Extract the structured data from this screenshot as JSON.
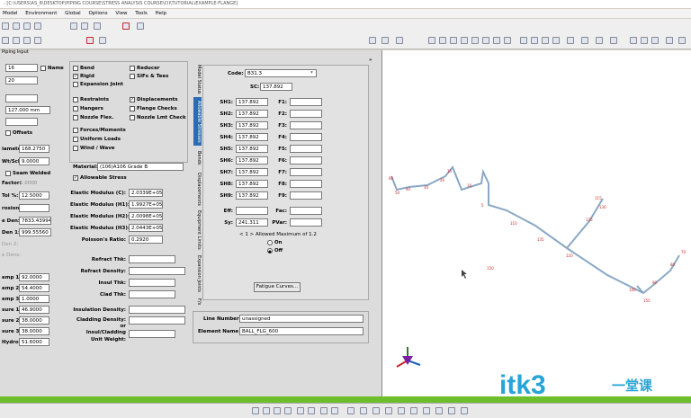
{
  "window": {
    "title": "- [C:\\USERS\\AS_8\\DESKTOP\\PIPING COURSE\\STRESS ANALYSIS COURSE\\CII\\TUTORIAL\\EXAMPLE-FLANGE]"
  },
  "menu": [
    "Model",
    "Environment",
    "Global",
    "Options",
    "View",
    "Tools",
    "Help"
  ],
  "panel": {
    "title": "Piping Input"
  },
  "left": {
    "from": "16",
    "to": "20",
    "dx": "",
    "dy": "127.000 mm",
    "dz": "",
    "name_label": "Name",
    "offsets_label": "Offsets",
    "diameter_label": "iameter:",
    "diameter": "168.2750",
    "wt_label": "Wt/Sch:",
    "wt": "9.0000",
    "seam_label": "Seam Welded",
    "factor_label": "Factor:",
    "factor": "1.0000",
    "mill_label": "Tol %:",
    "mill": "12.5000",
    "corr_label": "rosion:",
    "corr": "",
    "insul_label": "e Den:",
    "insul": "7833.43994",
    "fluid_label": "Den 1:",
    "fluid": "999.55560",
    "den2_label": "Den 2:",
    "other_label": "e Dens:",
    "temps": [
      {
        "label": "emp 1:",
        "value": "92.0000"
      },
      {
        "label": "emp 2:",
        "value": "54.4000"
      },
      {
        "label": "emp 3:",
        "value": "1.0000"
      },
      {
        "label": "sure 1:",
        "value": "46.9000"
      },
      {
        "label": "sure 2:",
        "value": "38.0000"
      },
      {
        "label": "sure 3:",
        "value": "38.0000"
      },
      {
        "label": "Hydro",
        "value": "51.6000"
      }
    ]
  },
  "mid": {
    "checks": [
      {
        "label": "Bend",
        "checked": false
      },
      {
        "label": "Reducer",
        "checked": false
      },
      {
        "label": "Rigid",
        "checked": true
      },
      {
        "label": "SIFs & Tees",
        "checked": false
      },
      {
        "label": "Expansion Joint",
        "checked": false
      },
      {
        "label": "Restraints",
        "checked": false
      },
      {
        "label": "Displacements",
        "checked": true
      },
      {
        "label": "Hangers",
        "checked": false
      },
      {
        "label": "Flange Checks",
        "checked": false
      },
      {
        "label": "Nozzle Flex.",
        "checked": false
      },
      {
        "label": "Nozzle Lmt Check",
        "checked": false
      },
      {
        "label": "Forces/Moments",
        "checked": false
      },
      {
        "label": "Uniform Loads",
        "checked": false
      },
      {
        "label": "Wind / Wave",
        "checked": false
      }
    ],
    "material_label": "Material:",
    "material": "(106)A106 Grade B",
    "allowable_label": "Allowable Stress",
    "elastic": [
      {
        "label": "Elastic Modulus (C):",
        "value": "2.0339E+05"
      },
      {
        "label": "Elastic Modulus (H1):",
        "value": "1.9927E+05"
      },
      {
        "label": "Elastic Modulus (H2):",
        "value": "2.0098E+05"
      },
      {
        "label": "Elastic Modulus (H3):",
        "value": "2.0443E+05"
      },
      {
        "label": "Poisson's Ratio:",
        "value": "0.2920"
      }
    ],
    "refract_thk": "Refract Thk:",
    "refract_den": "Refract Density:",
    "insul_thk": "Insul Thk:",
    "clad_thk": "Clad Thk:",
    "insul_den": "Insulation Density:",
    "clad_den": "Cladding Density:",
    "or": "or",
    "insul_clad": "Insul/Cladding",
    "unit_wt": "Unit Weight:"
  },
  "tabs": [
    "Model Status",
    "Allowable Stresses",
    "Bends",
    "Displacements",
    "Equipment Limits",
    "Expansion Joints",
    "F/x"
  ],
  "stress": {
    "code_label": "Code:",
    "code": "B31.3",
    "sc_label": "SC:",
    "sc": "137.892",
    "sh": [
      {
        "label": "SH1:",
        "value": "137.892"
      },
      {
        "label": "SH2:",
        "value": "137.892"
      },
      {
        "label": "SH3:",
        "value": "137.892"
      },
      {
        "label": "SH4:",
        "value": "137.892"
      },
      {
        "label": "SH5:",
        "value": "137.892"
      },
      {
        "label": "SH6:",
        "value": "137.892"
      },
      {
        "label": "SH7:",
        "value": "137.892"
      },
      {
        "label": "SH8:",
        "value": "137.892"
      },
      {
        "label": "SH9:",
        "value": "137.892"
      }
    ],
    "f": [
      "F1:",
      "F2:",
      "F3:",
      "F4:",
      "F5:",
      "F6:",
      "F7:",
      "F8:",
      "F9:"
    ],
    "eff_label": "Eff:",
    "fac_label": "Fac:",
    "sy_label": "Sy:",
    "sy": "241.311",
    "pvar_label": "PVar:",
    "allowed": "< 1 > Allowed Maximum of 1.2",
    "on": "On",
    "off": "Off",
    "fatigue_btn": "Fatigue Curves..."
  },
  "bottom_form": {
    "line_label": "Line Number",
    "line": "unassigned",
    "element_label": "Element Name",
    "element": "BALL_FLG_600"
  },
  "viewport_nodes": [
    "60",
    "50",
    "40",
    "30",
    "20",
    "15",
    "10",
    "5",
    "110",
    "115",
    "130",
    "125",
    "135",
    "120",
    "100",
    "90",
    "80",
    "70",
    "150",
    "155"
  ],
  "watermark": {
    "text": "itk3",
    "cn": "一堂课"
  },
  "colors": {
    "status": "#6cbf2a",
    "accent": "#27a4d8",
    "node": "#c62828"
  }
}
